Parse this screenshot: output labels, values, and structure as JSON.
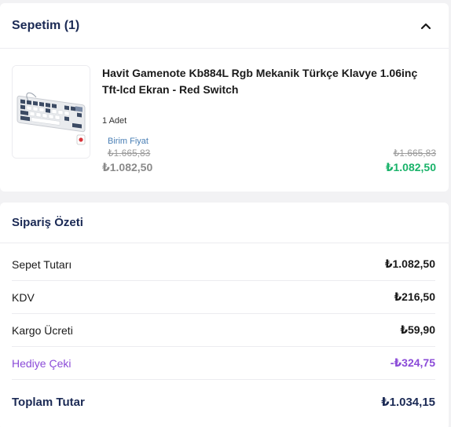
{
  "cart": {
    "title": "Sepetim (1)",
    "product": {
      "name": "Havit Gamenote Kb884L Rgb Mekanik Türkçe Klavye 1.06inç Tft-lcd Ekran - Red Switch",
      "quantity": "1 Adet",
      "unit_price_label": "Birim Fiyat",
      "unit_old_price": "₺1.665,83",
      "unit_price": "₺1.082,50",
      "total_old_price": "₺1.665,83",
      "total_price": "₺1.082,50"
    }
  },
  "summary": {
    "title": "Sipariş Özeti",
    "rows": [
      {
        "label": "Sepet Tutarı",
        "value": "₺1.082,50"
      },
      {
        "label": "KDV",
        "value": "₺216,50"
      },
      {
        "label": "Kargo Ücreti",
        "value": "₺59,90"
      },
      {
        "label": "Hediye Çeki",
        "value": "-₺324,75"
      }
    ],
    "total_label": "Toplam Tutar",
    "total_value": "₺1.034,15"
  },
  "colors": {
    "heading": "#1b2a55",
    "price_green": "#1ab36a",
    "gift_purple": "#8b4bd8",
    "unit_label_blue": "#4a7fb5"
  },
  "icons": {
    "collapse": "chevron-up-icon",
    "product_image": "keyboard-image"
  }
}
